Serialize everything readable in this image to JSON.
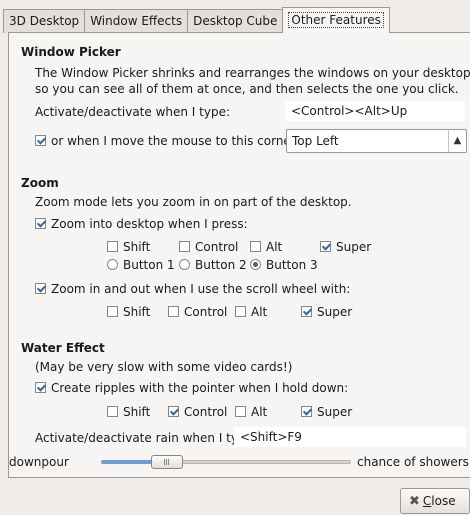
{
  "tabs": [
    "3D Desktop",
    "Window Effects",
    "Desktop Cube",
    "Other Features"
  ],
  "window_picker": {
    "title": "Window Picker",
    "desc_line1": "The Window Picker shrinks and rearranges the windows on your desktop",
    "desc_line2": "so you can see all of them at once, and then selects the one you click.",
    "activate_label": "Activate/deactivate when I type:",
    "activate_value": "<Control><Alt>Up",
    "mouse_corner_label": "or when I move the mouse to this corner:",
    "corner_value": "Top Left"
  },
  "zoom": {
    "title": "Zoom",
    "desc": "Zoom mode lets you zoom in on part of the desktop.",
    "zoom_into_label": "Zoom into desktop when I press:",
    "mod_shift": "Shift",
    "mod_control": "Control",
    "mod_alt": "Alt",
    "mod_super": "Super",
    "button1": "Button 1",
    "button2": "Button 2",
    "button3": "Button 3",
    "scroll_label": "Zoom in and out when I use the scroll wheel with:",
    "scroll_shift": "Shift",
    "scroll_control": "Control",
    "scroll_alt": "Alt",
    "scroll_super": "Super"
  },
  "water": {
    "title": "Water Effect",
    "note": "(May be very slow with some video cards!)",
    "ripples_label": "Create ripples with the pointer when I hold down:",
    "mod_shift": "Shift",
    "mod_control": "Control",
    "mod_alt": "Alt",
    "mod_super": "Super",
    "rain_label": "Activate/deactivate rain when I type:",
    "rain_value": "<Shift>F9",
    "slider_left": "downpour",
    "slider_right": "chance of showers",
    "slider_level": 0.23
  },
  "footer": {
    "close_label": "Close"
  },
  "colors": {
    "accent": "#3465a4",
    "slider_fill": "#6d9fd4"
  }
}
